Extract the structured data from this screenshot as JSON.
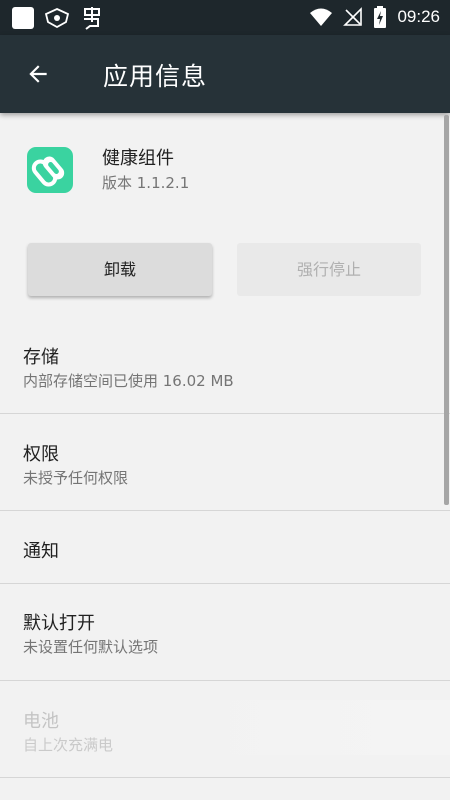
{
  "status_bar": {
    "time": "09:26",
    "left_icons": [
      "notification-square-icon",
      "badge-icon",
      "bug-app-icon"
    ],
    "right_icons": [
      "wifi-icon",
      "no-signal-icon",
      "battery-charging-icon"
    ]
  },
  "app_bar": {
    "title": "应用信息",
    "back_icon": "arrow-back-icon"
  },
  "app": {
    "name": "健康组件",
    "version": "版本 1.1.2.1",
    "icon_color": "#3ad3a0"
  },
  "buttons": {
    "uninstall": "卸载",
    "force_stop": "强行停止"
  },
  "items": [
    {
      "title": "存储",
      "subtitle": "内部存储空间已使用 16.02 MB"
    },
    {
      "title": "权限",
      "subtitle": "未授予任何权限"
    },
    {
      "title": "通知",
      "subtitle": ""
    },
    {
      "title": "默认打开",
      "subtitle": "未设置任何默认选项"
    },
    {
      "title": "电池",
      "subtitle": "自上次充满电"
    }
  ],
  "colors": {
    "status_bar": "#1e272c",
    "app_bar": "#263238",
    "background": "#f2f2f2"
  }
}
